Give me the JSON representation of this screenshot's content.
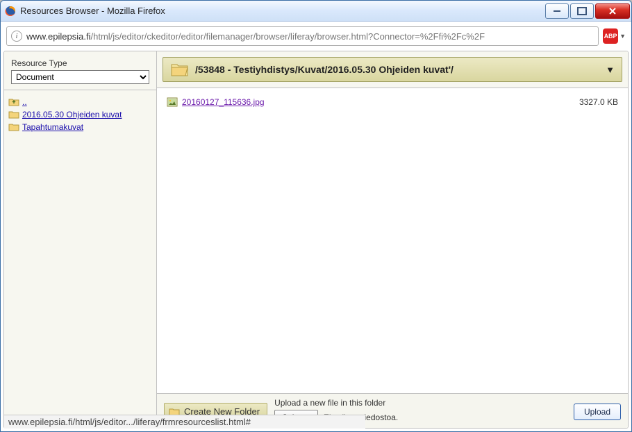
{
  "window": {
    "title": "Resources Browser - Mozilla Firefox"
  },
  "url": {
    "host": "www.epilepsia.fi",
    "path": "/html/js/editor/ckeditor/editor/filemanager/browser/liferay/browser.html?Connector=%2Ffi%2Fc%2F"
  },
  "abp": {
    "label": "ABP"
  },
  "sidebar": {
    "label": "Resource Type",
    "type_value": "Document",
    "tree": {
      "up": "..",
      "item1": "2016.05.30 Ohjeiden kuvat",
      "item2": "Tapahtumakuvat"
    }
  },
  "path": "/53848 - Testiyhdistys/Kuvat/2016.05.30 Ohjeiden kuvat'/",
  "files": {
    "f0": {
      "name": "20160127_115636.jpg",
      "size": "3327.0 KB"
    }
  },
  "bottom": {
    "create_folder": "Create New Folder",
    "upload_label": "Upload a new file in this folder",
    "browse": "Selaa...",
    "status": "Ei valittua tiedostoa.",
    "upload_btn": "Upload"
  },
  "status_bar": "www.epilepsia.fi/html/js/editor.../liferay/frmresourceslist.html#"
}
